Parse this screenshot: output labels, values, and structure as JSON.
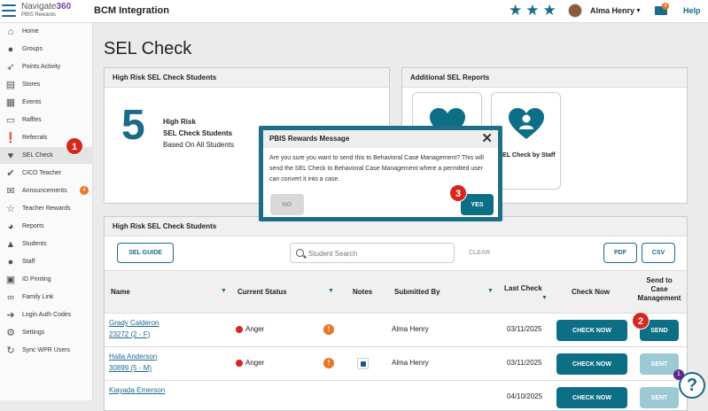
{
  "header": {
    "logo_main": "Navigate",
    "logo_num": "360",
    "logo_sub": "PBIS Rewards",
    "app_title": "BCM Integration",
    "user_name": "Alma Henry",
    "mail_count": "4",
    "help": "Help"
  },
  "sidebar": {
    "items": [
      {
        "label": "Home",
        "icon": "home-icon"
      },
      {
        "label": "Groups",
        "icon": "groups-icon"
      },
      {
        "label": "Points Activity",
        "icon": "rocket-icon"
      },
      {
        "label": "Stores",
        "icon": "cart-icon"
      },
      {
        "label": "Events",
        "icon": "calendar-icon"
      },
      {
        "label": "Raffles",
        "icon": "ticket-icon"
      },
      {
        "label": "Referrals",
        "icon": "alert-icon"
      },
      {
        "label": "SEL Check",
        "icon": "heart-check-icon"
      },
      {
        "label": "CICO Teacher",
        "icon": "check-circle-icon"
      },
      {
        "label": "Announcements",
        "icon": "envelope-icon",
        "badge": "4"
      },
      {
        "label": "Teacher Rewards",
        "icon": "star-icon"
      },
      {
        "label": "Reports",
        "icon": "pie-chart-icon"
      },
      {
        "label": "Students",
        "icon": "graduation-cap-icon"
      },
      {
        "label": "Staff",
        "icon": "person-icon"
      },
      {
        "label": "ID Printing",
        "icon": "printer-icon"
      },
      {
        "label": "Family Link",
        "icon": "link-icon"
      },
      {
        "label": "Login Auth Codes",
        "icon": "login-icon"
      },
      {
        "label": "Settings",
        "icon": "gear-icon"
      },
      {
        "label": "Sync WPR Users",
        "icon": "sync-icon"
      }
    ]
  },
  "markers": {
    "m1": "1",
    "m2": "2",
    "m3": "3"
  },
  "page": {
    "title": "SEL Check"
  },
  "high_risk": {
    "header": "High Risk SEL Check Students",
    "count": "5",
    "line1": "High Risk",
    "line2": "SEL Check Students",
    "line3": "Based On All Students"
  },
  "additional": {
    "header": "Additional SEL Reports",
    "card2_label": "SEL Check by Staff"
  },
  "table_section": {
    "header": "High Risk SEL Check Students",
    "guide_button": "SEL GUIDE",
    "search_placeholder": "Student Search",
    "clear": "CLEAR",
    "pdf": "PDF",
    "csv": "CSV",
    "columns": {
      "name": "Name",
      "status": "Current Status",
      "notes": "Notes",
      "submitted": "Submitted By",
      "last": "Last Check",
      "check_now": "Check Now",
      "send_l1": "Send to",
      "send_l2": "Case",
      "send_l3": "Management"
    },
    "rows": [
      {
        "name": "Grady Calderon",
        "id": "23272 (2 - F)",
        "status": "Anger",
        "by": "Alma Henry",
        "date": "03/11/2025",
        "check": "CHECK NOW",
        "send": "SEND"
      },
      {
        "name": "Halla Anderson",
        "id": "30899 (5 - M)",
        "status": "Anger",
        "by": "Alma Henry",
        "date": "03/11/2025",
        "check": "CHECK NOW",
        "send": "SENT"
      },
      {
        "name": "Kiayada Emerson",
        "date": "04/10/2025",
        "check": "CHECK NOW",
        "send": "SENT"
      }
    ]
  },
  "modal": {
    "title": "PBIS Rewards Message",
    "body": "Are you sure you want to send this to Behavioral Case Management? This will send the SEL Check to Behavioral Case Management where a permitted user can convert it into a case.",
    "no": "NO",
    "yes": "YES"
  },
  "help_fab": {
    "label": "?",
    "badge": "1"
  },
  "colors": {
    "accent": "#0d6f86",
    "alert": "#d9261c",
    "badge": "#e8772a"
  }
}
